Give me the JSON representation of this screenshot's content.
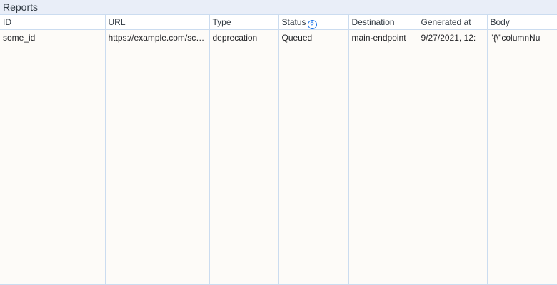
{
  "panel": {
    "title": "Reports"
  },
  "table": {
    "columns": {
      "id": "ID",
      "url": "URL",
      "type": "Type",
      "status": "Status",
      "destination": "Destination",
      "generated_at": "Generated at",
      "body": "Body"
    },
    "status_help_icon": "?",
    "rows": [
      {
        "id": "some_id",
        "url": "https://example.com/script.js",
        "type": "deprecation",
        "status": "Queued",
        "destination": "main-endpoint",
        "generated_at": "9/27/2021, 12:",
        "body": "\"{\\\"columnNu"
      }
    ]
  },
  "colors": {
    "header_bg": "#e9eef8",
    "grid_bg": "#fdfbf8",
    "border": "#cbdcf0",
    "accent": "#1a73e8"
  }
}
